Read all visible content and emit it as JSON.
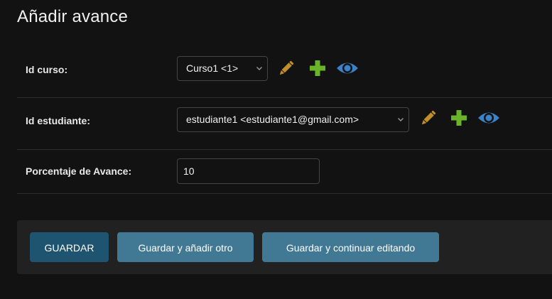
{
  "page": {
    "title": "Añadir avance"
  },
  "fields": {
    "curso": {
      "label": "Id curso:",
      "selected": "Curso1 <1>"
    },
    "estudiante": {
      "label": "Id estudiante:",
      "selected": "estudiante1 <estudiante1@gmail.com>"
    },
    "avance": {
      "label": "Porcentaje de Avance:",
      "value": "10"
    }
  },
  "icons": {
    "edit": "pencil-icon",
    "add": "plus-icon",
    "view": "eye-icon"
  },
  "colors": {
    "edit_icon": "#c18f2a",
    "add_icon": "#6ab42a",
    "view_icon": "#3b82c6",
    "primary_button": "#1f5470",
    "secondary_button": "#417893"
  },
  "buttons": {
    "save": "GUARDAR",
    "save_add_another": "Guardar y añadir otro",
    "save_continue": "Guardar y continuar editando"
  }
}
